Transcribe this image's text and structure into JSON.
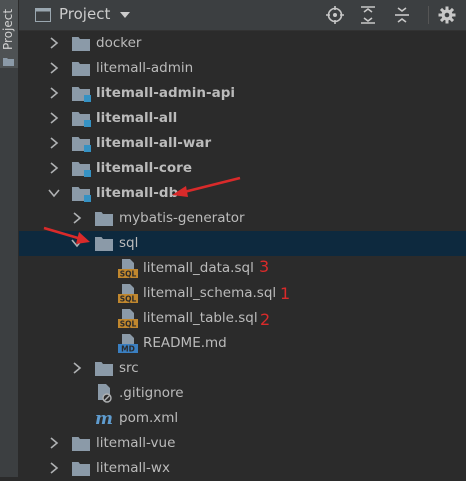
{
  "side_panel": {
    "label": "Project"
  },
  "header": {
    "title": "Project"
  },
  "tree": [
    {
      "label": "docker"
    },
    {
      "label": "litemall-admin"
    },
    {
      "label": "litemall-admin-api"
    },
    {
      "label": "litemall-all"
    },
    {
      "label": "litemall-all-war"
    },
    {
      "label": "litemall-core"
    },
    {
      "label": "litemall-db"
    },
    {
      "label": "mybatis-generator"
    },
    {
      "label": "sql"
    },
    {
      "label": "litemall_data.sql"
    },
    {
      "label": "litemall_schema.sql"
    },
    {
      "label": "litemall_table.sql"
    },
    {
      "label": "README.md"
    },
    {
      "label": "src"
    },
    {
      "label": ".gitignore"
    },
    {
      "label": "pom.xml"
    },
    {
      "label": "litemall-vue"
    },
    {
      "label": "litemall-wx"
    }
  ],
  "annotations": {
    "data_sql": "3",
    "schema_sql": "1",
    "table_sql": "2"
  },
  "icons": {
    "sql_badge": "SQL",
    "md_badge": "MD",
    "maven": "m",
    "colors": {
      "folder": "#8b9aa8",
      "module_badge": "#3592c4",
      "sql_badge": "#c0872e",
      "md_badge": "#3a7fc1",
      "selection": "#0d293e",
      "annotation": "#d92a2a"
    }
  }
}
